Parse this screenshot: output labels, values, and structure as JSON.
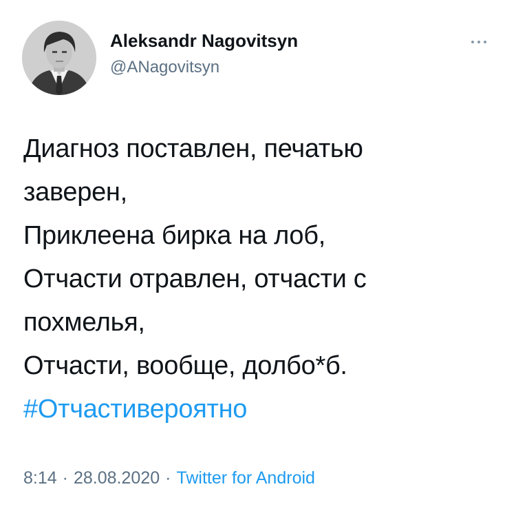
{
  "author": {
    "display_name": "Aleksandr Nagovitsyn",
    "handle": "@ANagovitsyn"
  },
  "more_icon": "more-horizontal-icon",
  "tweet_lines": [
    "Диагноз поставлен, печатью",
    "заверен,",
    "Приклеена бирка на лоб,",
    "Отчасти отравлен, отчасти с",
    "похмелья,",
    "Отчасти, вообще, долбо*б."
  ],
  "hashtag": "#Отчастивероятно",
  "meta": {
    "time": "8:14",
    "separator": "·",
    "date": "28.08.2020",
    "source": "Twitter for Android"
  },
  "colors": {
    "link": "#1d9bf0",
    "secondary_text": "#5b7083",
    "primary_text": "#0f1419"
  }
}
